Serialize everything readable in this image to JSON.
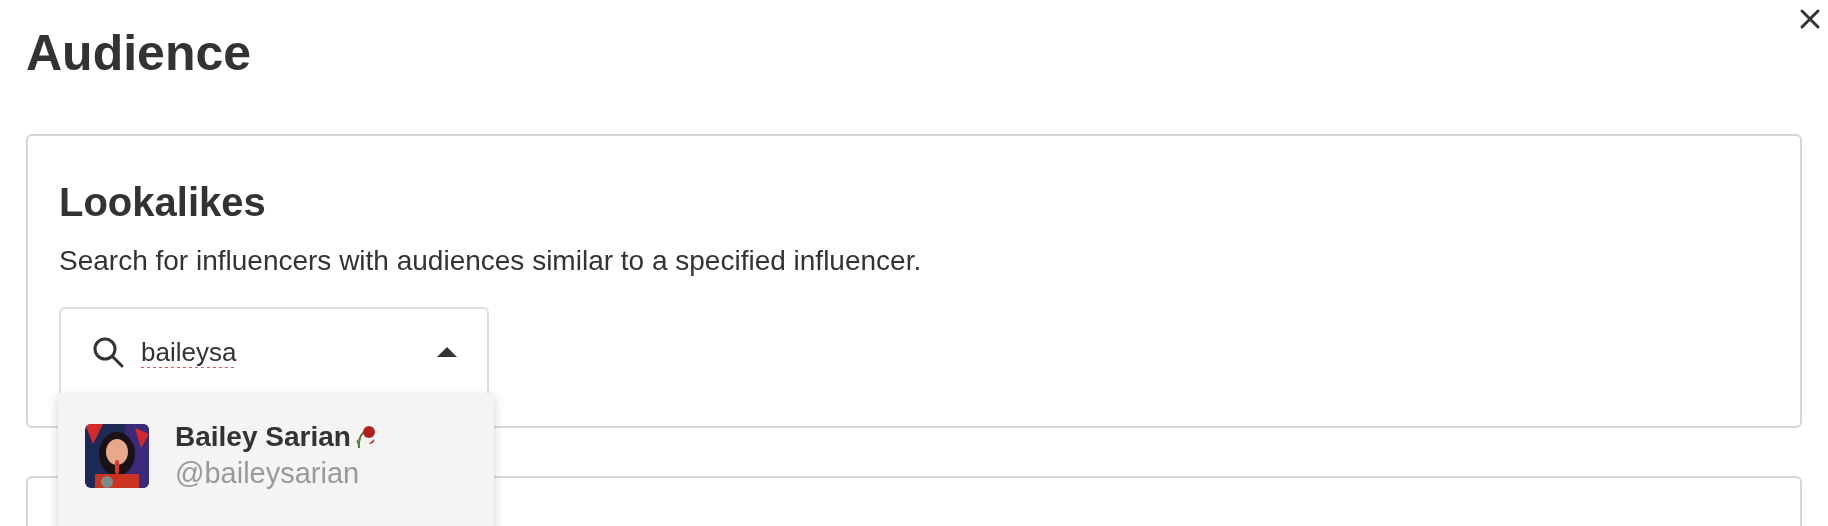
{
  "dialog": {
    "title": "Audience"
  },
  "lookalikes": {
    "title": "Lookalikes",
    "description": "Search for influencers with audiences similar to a specified influencer.",
    "search": {
      "value": "baileysa",
      "expanded": true
    },
    "results": [
      {
        "name": "Bailey Sarian",
        "handle": "@baileysarian"
      }
    ]
  }
}
